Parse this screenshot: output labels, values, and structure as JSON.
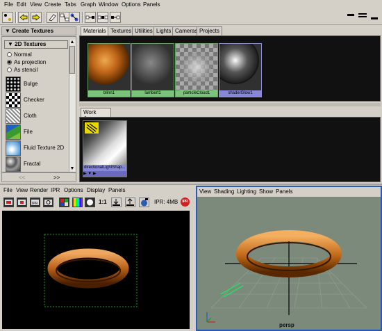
{
  "menubar": {
    "items": [
      "File",
      "Edit",
      "View",
      "Create",
      "Tabs",
      "Graph",
      "Window",
      "Options",
      "Panels"
    ]
  },
  "create_panel": {
    "header": "Create Textures",
    "section": "2D Textures",
    "radios": [
      {
        "label": "Normal",
        "selected": false
      },
      {
        "label": "As projection",
        "selected": true
      },
      {
        "label": "As stencil",
        "selected": false
      }
    ],
    "textures": [
      {
        "label": "Bulge",
        "icon": "bulge-swatch"
      },
      {
        "label": "Checker",
        "icon": "checker-swatch"
      },
      {
        "label": "Cloth",
        "icon": "cloth-swatch"
      },
      {
        "label": "File",
        "icon": "file-swatch"
      },
      {
        "label": "Fluid Texture 2D",
        "icon": "fluid-swatch"
      },
      {
        "label": "Fractal",
        "icon": "fractal-swatch"
      }
    ],
    "nav_prev": "<<",
    "nav_next": ">>"
  },
  "tabs": [
    "Materials",
    "Textures",
    "Utilities",
    "Lights",
    "Cameras",
    "Projects"
  ],
  "active_tab": "Materials",
  "materials": [
    {
      "name": "blinn1",
      "selected": false
    },
    {
      "name": "lambert1",
      "selected": false
    },
    {
      "name": "particleCloud1",
      "selected": false
    },
    {
      "name": "shaderGlow1",
      "selected": true
    }
  ],
  "work_area": {
    "tab": "Work Area",
    "node_name": "directionalLightShap...",
    "ports_label": "▶ ▼ ▶"
  },
  "render_view": {
    "menu": [
      "File",
      "View",
      "Render",
      "IPR",
      "Options",
      "Display",
      "Panels"
    ],
    "ratio_label": "1:1",
    "ipr_label": "IPR: 4MB",
    "ipr_badge": "IPR"
  },
  "persp_view": {
    "menu": [
      "View",
      "Shading",
      "Lighting",
      "Show",
      "Panels"
    ],
    "camera_label": "persp"
  },
  "colors": {
    "accent": "#2a5ab8",
    "material_caption": "#7bc47b",
    "selected_caption": "#8888d8"
  }
}
